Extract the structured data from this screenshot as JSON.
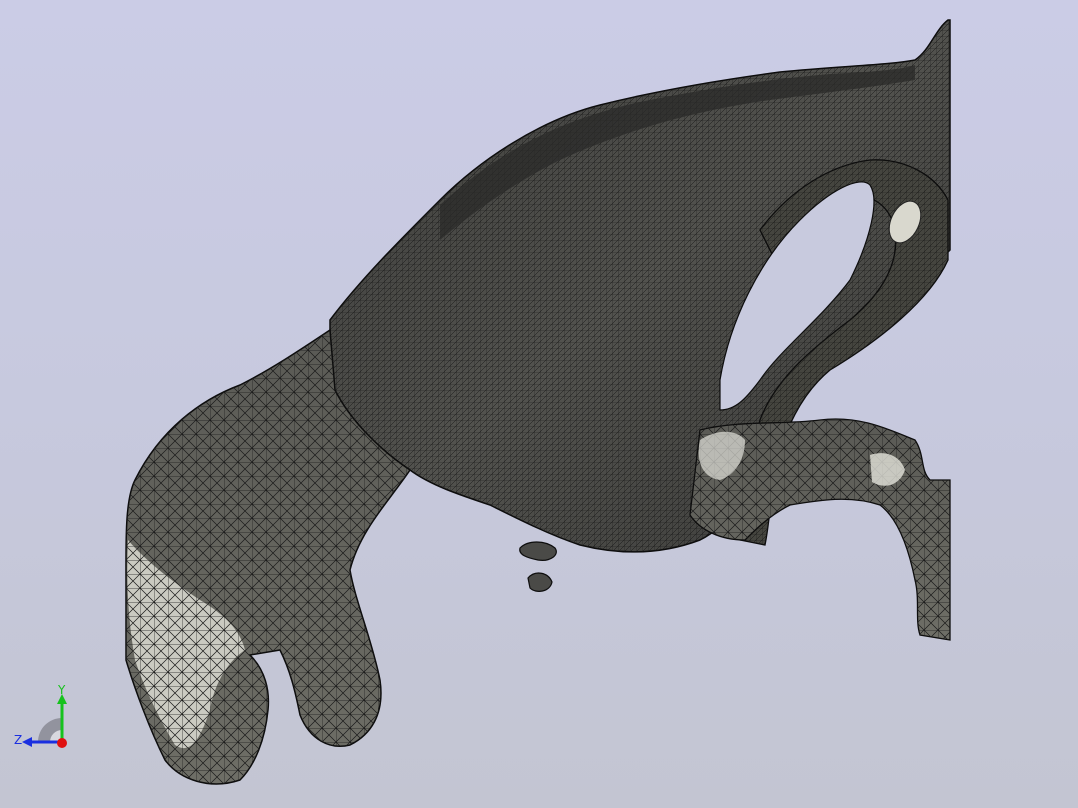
{
  "viewport": {
    "background_top": "#cbcce6",
    "background_bottom": "#c3c5d2",
    "mesh_fill": "#4a4a47",
    "mesh_highlight": "#e7e7df",
    "mesh_edge": "#0d0d0d"
  },
  "triad": {
    "y_label": "Y",
    "z_label": "Z",
    "y_color": "#16c21d",
    "z_color": "#1a2fe0",
    "x_color": "#e01010"
  }
}
